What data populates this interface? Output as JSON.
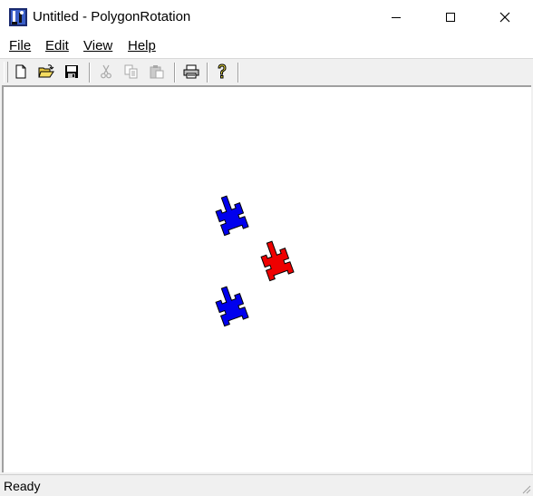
{
  "window": {
    "title": "Untitled - PolygonRotation",
    "app_icon": "polygon-rotation-app-icon"
  },
  "menu": {
    "file": "File",
    "edit": "Edit",
    "view": "View",
    "help": "Help"
  },
  "toolbar": {
    "buttons": [
      {
        "icon": "new-document-icon",
        "enabled": true
      },
      {
        "icon": "open-folder-icon",
        "enabled": true
      },
      {
        "icon": "save-disk-icon",
        "enabled": true
      },
      {
        "icon": "cut-scissors-icon",
        "enabled": false
      },
      {
        "icon": "copy-icon",
        "enabled": false
      },
      {
        "icon": "paste-icon",
        "enabled": false
      },
      {
        "icon": "print-icon",
        "enabled": true
      },
      {
        "icon": "help-question-icon",
        "enabled": true
      }
    ]
  },
  "canvas": {
    "polygons": [
      {
        "color": "#0000ee"
      },
      {
        "color": "#ee0000"
      },
      {
        "color": "#0000ee"
      }
    ]
  },
  "status": {
    "text": "Ready"
  }
}
